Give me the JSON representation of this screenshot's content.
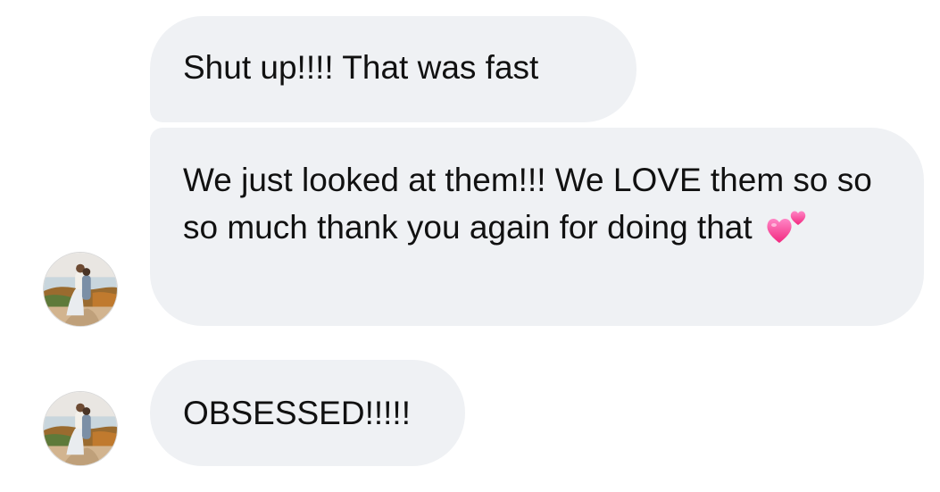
{
  "messages": [
    {
      "text": "Shut up!!!! That was fast"
    },
    {
      "text": "We just looked at them!!! We LOVE them so so so much thank you again for doing that",
      "emoji": "two-hearts-icon"
    },
    {
      "text": "OBSESSED!!!!!"
    }
  ],
  "colors": {
    "bubble_bg": "#eff1f4",
    "text": "#111111",
    "heart": "#ff4fa3"
  }
}
